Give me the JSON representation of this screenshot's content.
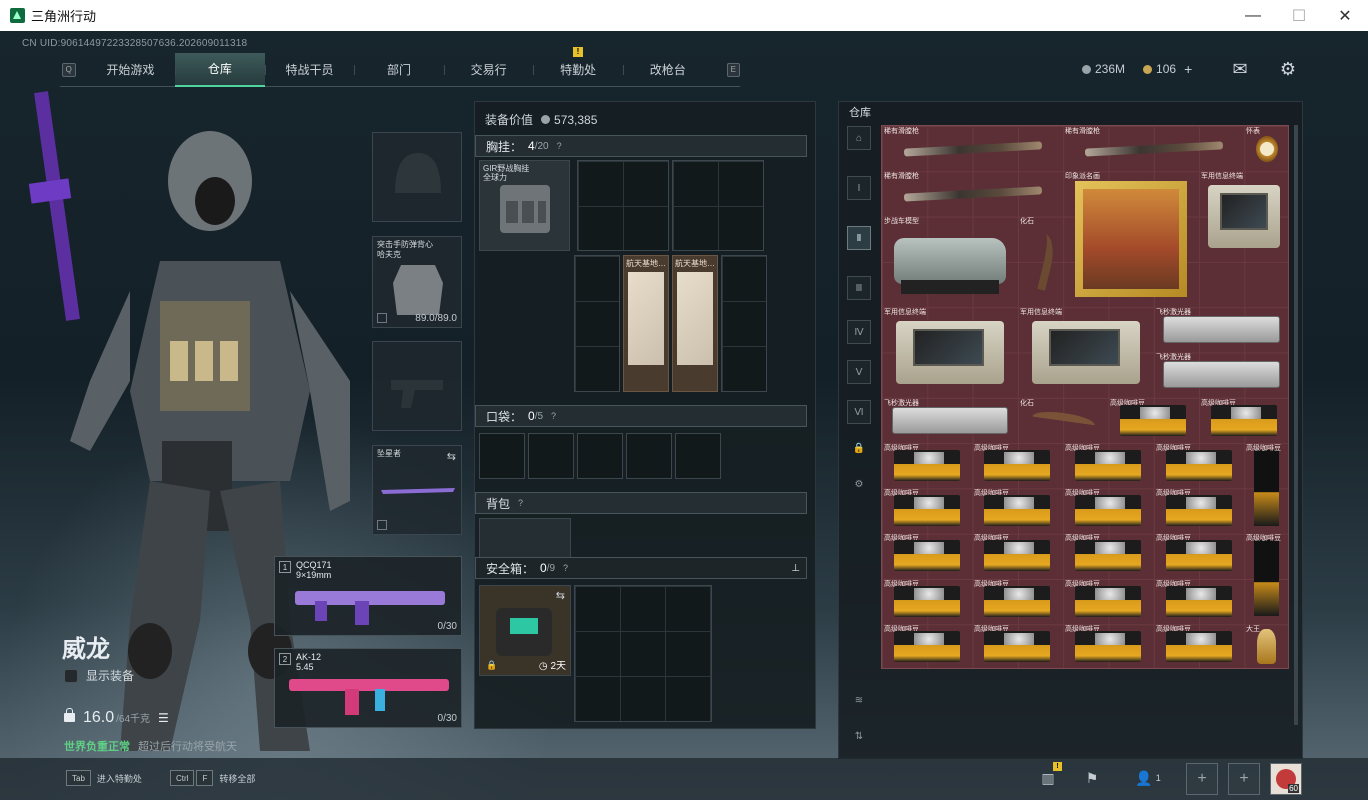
{
  "window": {
    "title": "三角洲行动",
    "minimize": "—",
    "maximize": "☐",
    "close": "✕"
  },
  "uid_line": "CN UID:9061449722332850763​6.202609011318",
  "nav": {
    "left_key": "Q",
    "right_key": "E",
    "tabs": [
      "开始游戏",
      "仓库",
      "特战干员",
      "部门",
      "交易行",
      "特勤处",
      "改枪台"
    ],
    "active": "仓库",
    "alert_tab": "特勤处",
    "alert_mark": "!"
  },
  "currency": {
    "silver": "236M",
    "gold": "106",
    "add": "+"
  },
  "operator": {
    "name": "威龙",
    "show_equipment": "显示装备",
    "weight_value": "16.0",
    "weight_max": "/64千克",
    "status_text": "世界负重正常",
    "status_sub": "超过后行动将受航天"
  },
  "equip_slots": {
    "vest_label": "突击手防弹背心\n哈夫克",
    "vest_durability": "89.0/89.0",
    "melee_label": "坠星者"
  },
  "weapons": [
    {
      "num": "1",
      "name": "QCQ171\n9×19mm",
      "ammo": "0/30"
    },
    {
      "num": "2",
      "name": "AK-12\n5.45",
      "ammo": "0/30"
    }
  ],
  "mid": {
    "equip_value_label": "装备价值",
    "equip_value": "573,385",
    "chest_label": "胸挂：",
    "chest_count": "4",
    "chest_total": "/20",
    "chest_item": "GIR野战胸挂\n全球力",
    "maps": [
      "航天基地…",
      "航天基地…"
    ],
    "pocket_label": "口袋：",
    "pocket_count": "0",
    "pocket_total": "/5",
    "backpack_label": "背包",
    "safe_label": "安全箱：",
    "safe_count": "0",
    "safe_total": "/9",
    "safe_timer": "2天",
    "help": "?"
  },
  "storage": {
    "title": "仓库",
    "items": [
      "稀有滑膛枪",
      "稀有滑膛枪",
      "怀表",
      "稀有滑膛枪",
      "印象派名画",
      "军用信息终端",
      "步战车模型",
      "化石",
      "军用信息终端",
      "军用信息终端",
      "飞秒激光器",
      "飞秒激光器",
      "飞秒激光器",
      "化石",
      "高级咖啡豆",
      "高级咖啡豆",
      "高级咖啡豆",
      "大王"
    ]
  },
  "footer": {
    "tab_key": "Tab",
    "tab_label": "进入特勤处",
    "ctrl_key": "Ctrl",
    "f_key": "F",
    "transfer_label": "转移全部",
    "squad_count": "1",
    "avatar_level": "60",
    "alert_mark": "!"
  },
  "colors": {
    "accent": "#4fd69c",
    "storage_bg": "#5b2f35",
    "alert": "#e7c12a"
  }
}
